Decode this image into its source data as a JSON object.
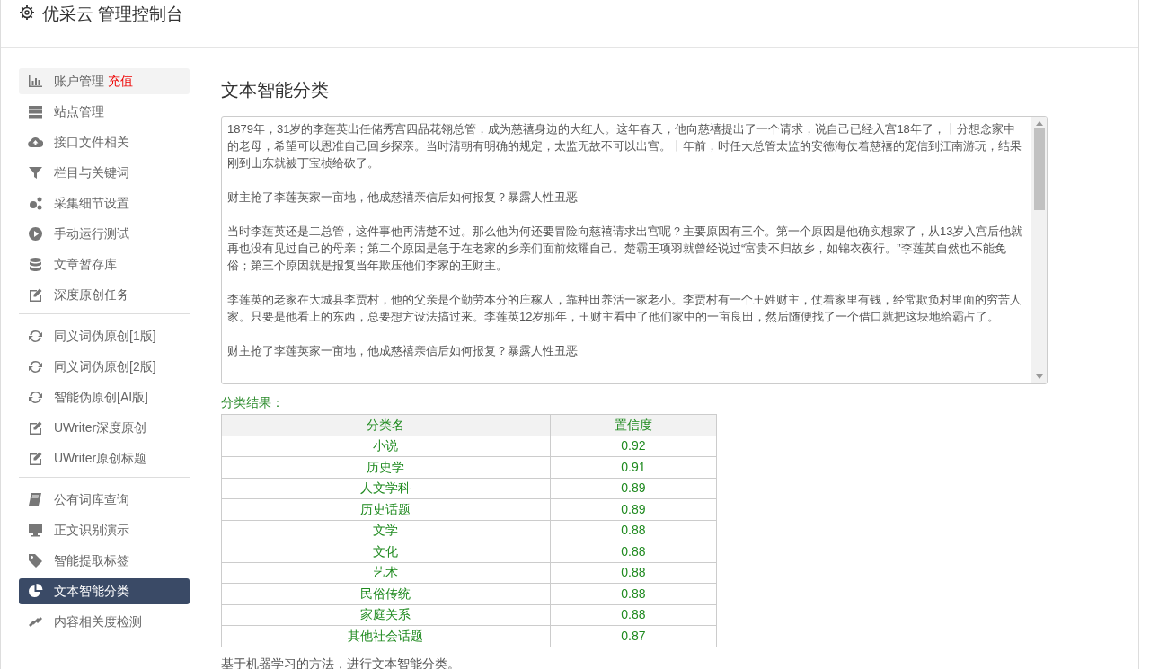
{
  "header": {
    "title": "优采云 管理控制台"
  },
  "sidebar": {
    "groups": [
      [
        {
          "label": "账户管理",
          "tag": "充值",
          "highlighted": true,
          "selected": false
        },
        {
          "label": "站点管理",
          "highlighted": false,
          "selected": false
        },
        {
          "label": "接口文件相关",
          "highlighted": false,
          "selected": false
        },
        {
          "label": "栏目与关键词",
          "highlighted": false,
          "selected": false
        },
        {
          "label": "采集细节设置",
          "highlighted": false,
          "selected": false
        },
        {
          "label": "手动运行测试",
          "highlighted": false,
          "selected": false
        },
        {
          "label": "文章暂存库",
          "highlighted": false,
          "selected": false
        },
        {
          "label": "深度原创任务",
          "highlighted": false,
          "selected": false
        }
      ],
      [
        {
          "label": "同义词伪原创[1版]",
          "highlighted": false,
          "selected": false
        },
        {
          "label": "同义词伪原创[2版]",
          "highlighted": false,
          "selected": false
        },
        {
          "label": "智能伪原创[AI版]",
          "highlighted": false,
          "selected": false
        },
        {
          "label": "UWriter深度原创",
          "highlighted": false,
          "selected": false
        },
        {
          "label": "UWriter原创标题",
          "highlighted": false,
          "selected": false
        }
      ],
      [
        {
          "label": "公有词库查询",
          "highlighted": false,
          "selected": false
        },
        {
          "label": "正文识别演示",
          "highlighted": false,
          "selected": false
        },
        {
          "label": "智能提取标签",
          "highlighted": false,
          "selected": false
        },
        {
          "label": "文本智能分类",
          "highlighted": false,
          "selected": true
        },
        {
          "label": "内容相关度检测",
          "highlighted": false,
          "selected": false
        }
      ]
    ]
  },
  "main": {
    "title": "文本智能分类",
    "text_paragraphs": [
      "1879年，31岁的李莲英出任储秀宫四品花翎总管，成为慈禧身边的大红人。这年春天，他向慈禧提出了一个请求，说自己已经入宫18年了，十分想念家中的老母，希望可以恩准自己回乡探亲。当时清朝有明确的规定，太监无故不可以出宫。十年前，时任大总管太监的安德海仗着慈禧的宠信到江南游玩，结果刚到山东就被丁宝桢给砍了。",
      "财主抢了李莲英家一亩地，他成慈禧亲信后如何报复？暴露人性丑恶",
      "当时李莲英还是二总管，这件事他再清楚不过。那么他为何还要冒险向慈禧请求出宫呢？主要原因有三个。第一个原因是他确实想家了，从13岁入宫后他就再也没有见过自己的母亲；第二个原因是急于在老家的乡亲们面前炫耀自己。楚霸王项羽就曾经说过“富贵不归故乡，如锦衣夜行。”李莲英自然也不能免俗；第三个原因就是报复当年欺压他们李家的王财主。",
      "李莲英的老家在大城县李贾村，他的父亲是个勤劳本分的庄稼人，靠种田养活一家老小。李贾村有一个王姓财主，仗着家里有钱，经常欺负村里面的穷苦人家。只要是他看上的东西，总要想方设法搞过来。李莲英12岁那年，王财主看中了他们家中的一亩良田，然后随便找了一个借口就把这块地给霸占了。",
      "财主抢了李莲英家一亩地，他成慈禧亲信后如何报复？暴露人性丑恶"
    ],
    "result_label": "分类结果：",
    "table": {
      "columns": [
        "分类名",
        "置信度"
      ],
      "rows": [
        [
          "小说",
          "0.92"
        ],
        [
          "历史学",
          "0.91"
        ],
        [
          "人文学科",
          "0.89"
        ],
        [
          "历史话题",
          "0.89"
        ],
        [
          "文学",
          "0.88"
        ],
        [
          "文化",
          "0.88"
        ],
        [
          "艺术",
          "0.88"
        ],
        [
          "民俗传统",
          "0.88"
        ],
        [
          "家庭关系",
          "0.88"
        ],
        [
          "其他社会话题",
          "0.87"
        ]
      ]
    },
    "footnote": "基于机器学习的方法，进行文本智能分类。"
  }
}
